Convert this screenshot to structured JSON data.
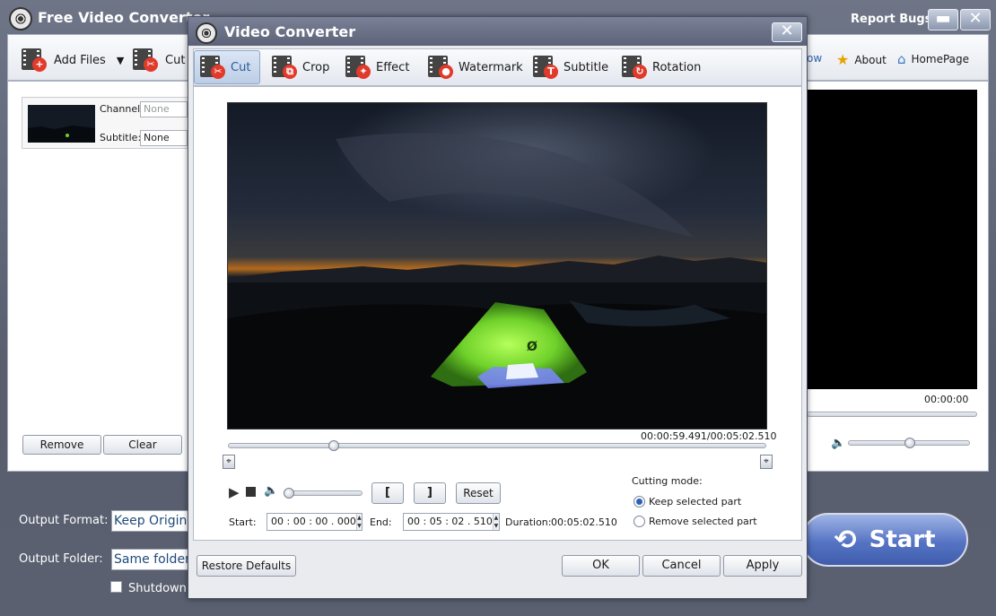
{
  "main": {
    "title": "Free Video Converter",
    "report_bugs": "Report Bugs",
    "toolbar": {
      "add_files": "Add Files",
      "cut": "Cut",
      "about": "About",
      "homepage": "HomePage"
    },
    "file": {
      "channel_label": "Channel:",
      "channel_value": "None",
      "subtitle_label": "Subtitle:",
      "subtitle_value": "None"
    },
    "remove_label": "Remove",
    "clear_label": "Clear",
    "preview_time": "00:00:00",
    "output_format_label": "Output Format:",
    "output_format_value": "Keep Original",
    "output_folder_label": "Output Folder:",
    "output_folder_value": "Same folder as the",
    "shutdown_label": "Shutdown after",
    "start_label": "Start"
  },
  "dialog": {
    "title": "Video Converter",
    "tabs": [
      {
        "label": "Cut",
        "icon": "scissors-icon",
        "active": true
      },
      {
        "label": "Crop",
        "icon": "crop-icon",
        "active": false
      },
      {
        "label": "Effect",
        "icon": "effect-wand-icon",
        "active": false
      },
      {
        "label": "Watermark",
        "icon": "watermark-drop-icon",
        "active": false
      },
      {
        "label": "Subtitle",
        "icon": "subtitle-t-icon",
        "active": false
      },
      {
        "label": "Rotation",
        "icon": "rotation-icon",
        "active": false
      }
    ],
    "current_time": "00:00:59.491",
    "total_time": "00:05:02.510",
    "time_separator": "/",
    "reset_label": "Reset",
    "start_label": "Start:",
    "start_value": "00 : 00 : 00 . 000",
    "end_label": "End:",
    "end_value": "00 : 05 : 02 . 510",
    "duration_label": "Duration:",
    "duration_value": "00:05:02.510",
    "cutting_mode_label": "Cutting mode:",
    "keep_label": "Keep selected part",
    "remove_label": "Remove selected part",
    "cutting_mode_selected": "Keep selected part",
    "seek_position": 0.197,
    "restore_defaults": "Restore Defaults",
    "ok": "OK",
    "cancel": "Cancel",
    "apply": "Apply",
    "accent": "#2c5fb8",
    "tent_color": "#6fd12a"
  }
}
